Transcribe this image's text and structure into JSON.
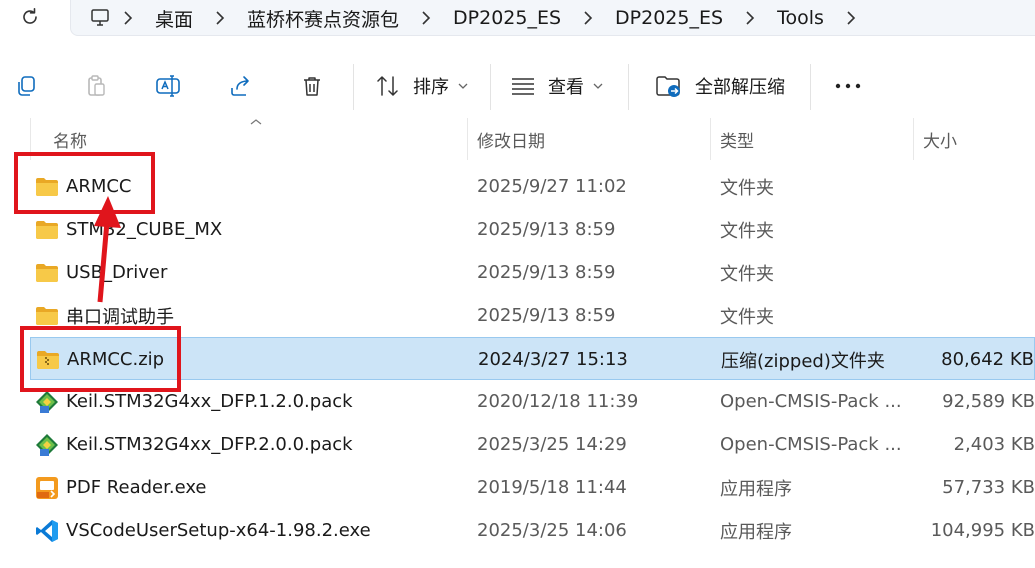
{
  "address_bar": {
    "breadcrumbs": [
      "桌面",
      "蓝桥杯赛点资源包",
      "DP2025_ES",
      "DP2025_ES",
      "Tools"
    ]
  },
  "toolbar": {
    "sort_label": "排序",
    "view_label": "查看",
    "extract_all_label": "全部解压缩",
    "more_label": "•••"
  },
  "columns": {
    "name": "名称",
    "date": "修改日期",
    "type": "类型",
    "size": "大小"
  },
  "files": [
    {
      "name": "ARMCC",
      "date": "2025/9/27 11:02",
      "type": "文件夹",
      "size": "",
      "icon": "folder-icon"
    },
    {
      "name": "STM32_CUBE_MX",
      "date": "2025/9/13 8:59",
      "type": "文件夹",
      "size": "",
      "icon": "folder-icon"
    },
    {
      "name": "USB_Driver",
      "date": "2025/9/13 8:59",
      "type": "文件夹",
      "size": "",
      "icon": "folder-icon"
    },
    {
      "name": "串口调试助手",
      "date": "2025/9/13 8:59",
      "type": "文件夹",
      "size": "",
      "icon": "folder-icon"
    },
    {
      "name": "ARMCC.zip",
      "date": "2024/3/27 15:13",
      "type": "压缩(zipped)文件夹",
      "size": "80,642 KB",
      "icon": "zip-folder-icon",
      "selected": true
    },
    {
      "name": "Keil.STM32G4xx_DFP.1.2.0.pack",
      "date": "2020/12/18 11:39",
      "type": "Open-CMSIS-Pack ...",
      "size": "92,589 KB",
      "icon": "cmsis-pack-icon"
    },
    {
      "name": "Keil.STM32G4xx_DFP.2.0.0.pack",
      "date": "2025/3/25 14:29",
      "type": "Open-CMSIS-Pack ...",
      "size": "2,403 KB",
      "icon": "cmsis-pack-icon"
    },
    {
      "name": "PDF Reader.exe",
      "date": "2019/5/18 11:44",
      "type": "应用程序",
      "size": "57,733 KB",
      "icon": "pdf-reader-icon"
    },
    {
      "name": "VSCodeUserSetup-x64-1.98.2.exe",
      "date": "2025/3/25 14:06",
      "type": "应用程序",
      "size": "104,995 KB",
      "icon": "vscode-icon"
    }
  ],
  "colors": {
    "annotation_red": "#e0151c",
    "selection_bg": "#cce4f7",
    "folder_yellow": "#f7c948"
  }
}
